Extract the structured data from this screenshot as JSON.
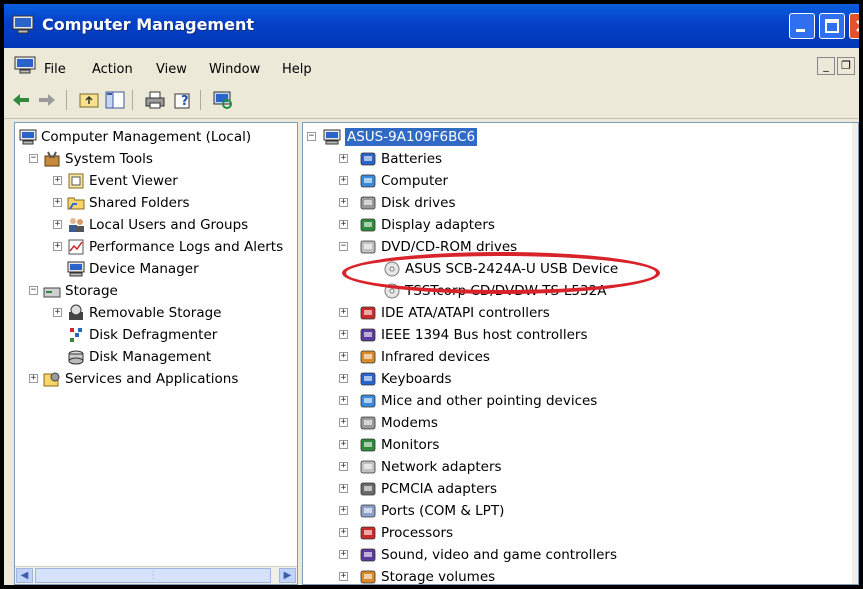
{
  "window": {
    "title": "Computer Management"
  },
  "menubar": {
    "items": [
      "File",
      "Action",
      "View",
      "Window",
      "Help"
    ],
    "mdi_min": "_",
    "mdi_restore": "❐"
  },
  "toolbar": {
    "back": "⇦",
    "forward": "⇨"
  },
  "left_tree": {
    "root": "Computer Management (Local)",
    "system_tools": "System Tools",
    "event_viewer": "Event Viewer",
    "shared_folders": "Shared Folders",
    "local_users": "Local Users and Groups",
    "perf_logs": "Performance Logs and Alerts",
    "device_manager": "Device Manager",
    "storage": "Storage",
    "removable_storage": "Removable Storage",
    "disk_defrag": "Disk Defragmenter",
    "disk_mgmt": "Disk Management",
    "services": "Services and Applications"
  },
  "right_tree": {
    "root": "ASUS-9A109F6BC6",
    "items": [
      "Batteries",
      "Computer",
      "Disk drives",
      "Display adapters",
      "DVD/CD-ROM drives"
    ],
    "dvd_children": [
      "ASUS SCB-2424A-U USB Device",
      "TSSTcorp CD/DVDW TS-L532A"
    ],
    "items2": [
      "IDE ATA/ATAPI controllers",
      "IEEE 1394 Bus host controllers",
      "Infrared devices",
      "Keyboards",
      "Mice and other pointing devices",
      "Modems",
      "Monitors",
      "Network adapters",
      "PCMCIA adapters",
      "Ports (COM & LPT)",
      "Processors",
      "Sound, video and game controllers",
      "Storage volumes"
    ]
  },
  "colors": {
    "titlebar": "#0542c9",
    "selection": "#316ac5",
    "annotation": "#d9232b"
  }
}
